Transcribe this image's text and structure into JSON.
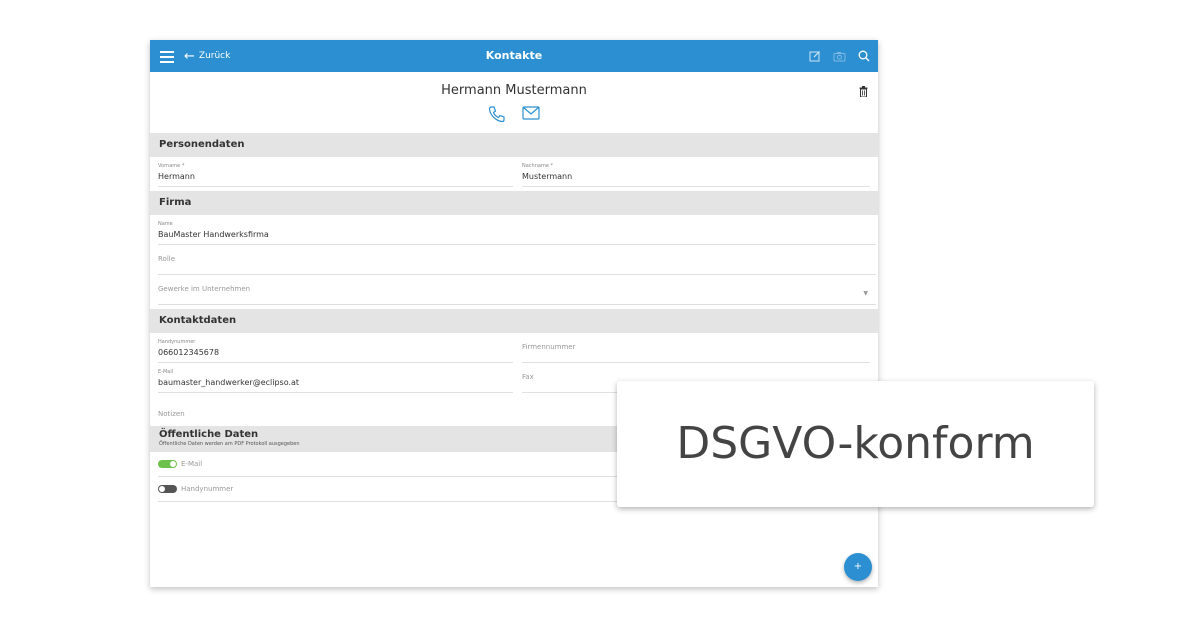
{
  "topbar": {
    "back_label": "Zurück",
    "title": "Kontakte"
  },
  "contact": {
    "name": "Hermann Mustermann"
  },
  "sections": {
    "personal": "Personendaten",
    "company": "Firma",
    "contact": "Kontaktdaten",
    "public": "Öffentliche Daten",
    "public_sub": "Öffentliche Daten werden am PDF Protokoll ausgegeben"
  },
  "fields": {
    "firstname": {
      "label": "Vorname *",
      "value": "Hermann"
    },
    "lastname": {
      "label": "Nachname *",
      "value": "Mustermann"
    },
    "company_name": {
      "label": "Name",
      "value": "BauMaster Handwerksfirma"
    },
    "role": {
      "placeholder": "Rolle"
    },
    "trades": {
      "placeholder": "Gewerke im Unternehmen"
    },
    "mobile": {
      "label": "Handynummer",
      "value": "066012345678"
    },
    "company_number": {
      "placeholder": "Firmennummer"
    },
    "email": {
      "label": "E-Mail",
      "value": "baumaster_handwerker@eclipso.at"
    },
    "fax": {
      "placeholder": "Fax"
    },
    "notes": {
      "placeholder": "Notizen"
    }
  },
  "toggles": [
    {
      "label": "E-Mail",
      "on": true
    },
    {
      "label": "Handynummer",
      "on": false
    }
  ],
  "fab": {
    "label": "+"
  },
  "callout": {
    "text": "DSGVO-konform"
  },
  "colors": {
    "primary": "#2b8fd1",
    "toggle_on": "#6cc24a",
    "section_bg": "#e4e4e4"
  }
}
